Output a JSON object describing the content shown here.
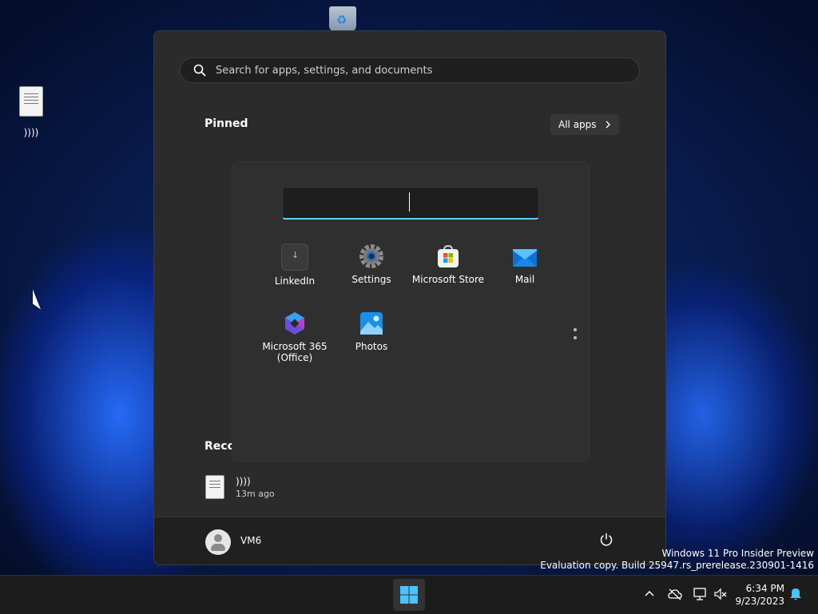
{
  "desktop": {
    "file_label": "))))"
  },
  "start_menu": {
    "search_placeholder": "Search for apps, settings, and documents",
    "pinned_title": "Pinned",
    "all_apps_label": "All apps",
    "recent_title": "Reco",
    "recent_items": [
      {
        "name": "))))",
        "time": "13m ago"
      }
    ],
    "user": {
      "name": "VM6"
    }
  },
  "folder": {
    "name_value": "",
    "apps": [
      {
        "label": "LinkedIn"
      },
      {
        "label": "Settings"
      },
      {
        "label": "Microsoft Store"
      },
      {
        "label": "Mail"
      },
      {
        "label": "Microsoft 365\n(Office)"
      },
      {
        "label": "Photos"
      }
    ]
  },
  "watermark": {
    "line1": "Windows 11 Pro Insider Preview",
    "line2": "Evaluation copy. Build 25947.rs_prerelease.230901-1416"
  },
  "taskbar": {
    "time": "6:34 PM",
    "date": "9/23/2023"
  },
  "colors": {
    "accent": "#60cdff",
    "menu_bg": "#2b2b2b",
    "taskbar_bg": "#1c1c1c"
  }
}
